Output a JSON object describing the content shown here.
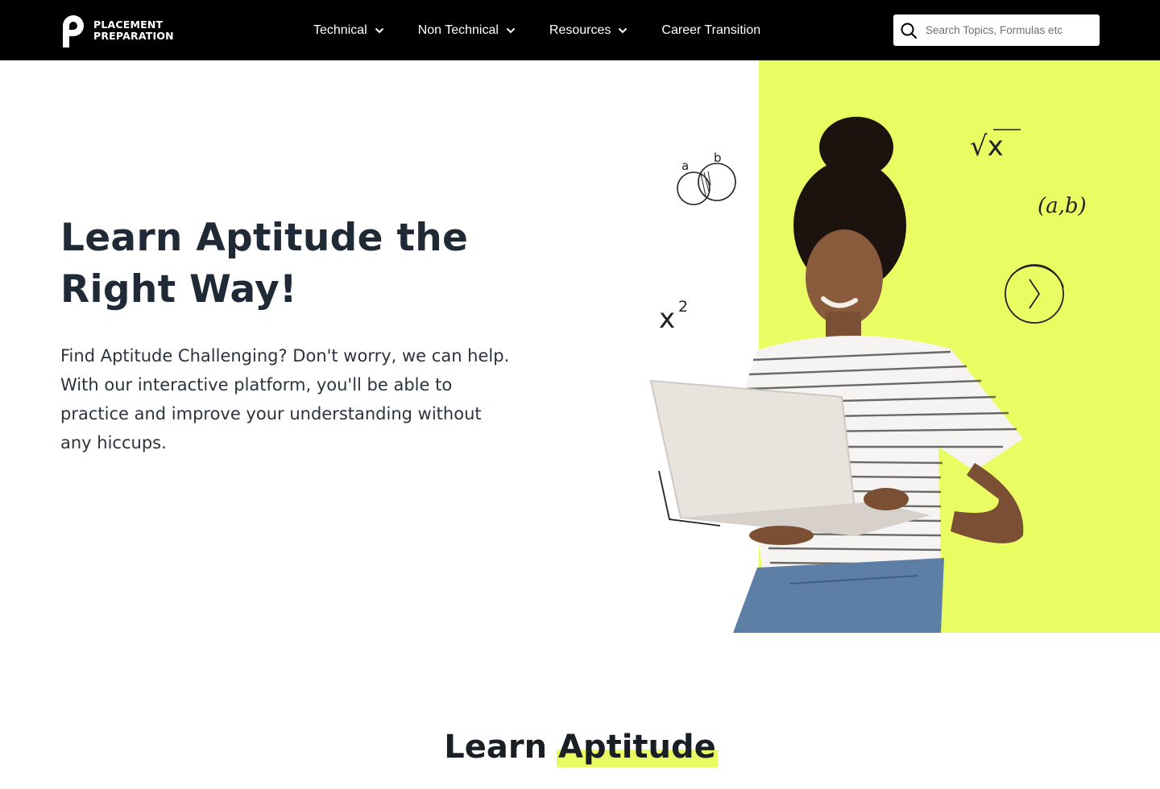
{
  "brand": {
    "line1": "PLACEMENT",
    "line2": "PREPARATION",
    "icon": "p-logo-icon"
  },
  "nav": {
    "items": [
      {
        "label": "Technical",
        "has_dropdown": true
      },
      {
        "label": "Non Technical",
        "has_dropdown": true
      },
      {
        "label": "Resources",
        "has_dropdown": true
      },
      {
        "label": "Career Transition",
        "has_dropdown": false
      }
    ]
  },
  "search": {
    "placeholder": "Search Topics, Formulas etc",
    "value": "",
    "icon": "search-icon"
  },
  "hero": {
    "title_line1": "Learn Aptitude the",
    "title_line2": "Right Way!",
    "description": "Find Aptitude Challenging? Don't worry, we can help. With our interactive platform, you'll be able to practice and improve your understanding without any hiccups.",
    "doodles": {
      "venn_a": "a",
      "venn_b": "b",
      "sqrt": "√x",
      "pair": "(a,b)",
      "x_base": "x",
      "x_exp": "2"
    }
  },
  "section": {
    "title_plain": "Learn",
    "title_highlight": "Aptitude"
  },
  "colors": {
    "topbar": "#000000",
    "accent_yellow": "#e9fd63",
    "heading": "#1f2a36",
    "body_text": "#2c333d"
  }
}
